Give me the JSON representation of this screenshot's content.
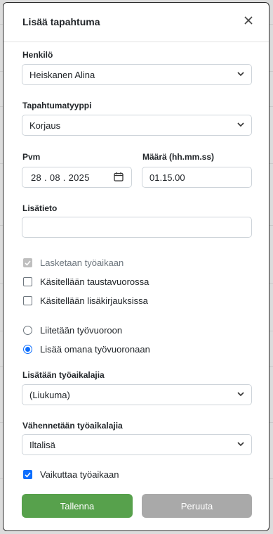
{
  "dialog": {
    "title": "Lisää tapahtuma",
    "close_icon": "close-icon"
  },
  "fields": {
    "person": {
      "label": "Henkilö",
      "value": "Heiskanen Alina"
    },
    "event_type": {
      "label": "Tapahtumatyyppi",
      "value": "Korjaus"
    },
    "date": {
      "label": "Pvm",
      "day": "28",
      "month": "08",
      "year": "2025"
    },
    "amount": {
      "label": "Määrä (hh.mm.ss)",
      "value": "01.15.00"
    },
    "extra": {
      "label": "Lisätieto",
      "value": ""
    }
  },
  "checkboxes": [
    {
      "label": "Lasketaan työaikaan",
      "checked": true,
      "disabled": true
    },
    {
      "label": "Käsitellään taustavuorossa",
      "checked": false,
      "disabled": false
    },
    {
      "label": "Käsitellään lisäkirjauksissa",
      "checked": false,
      "disabled": false
    }
  ],
  "radios": [
    {
      "label": "Liitetään työvuoroon",
      "selected": false
    },
    {
      "label": "Lisää omana työvuoronaan",
      "selected": true
    }
  ],
  "work_type_add": {
    "label": "Lisätään työaikalajia",
    "value": "(Liukuma)"
  },
  "work_type_sub": {
    "label": "Vähennetään työaikalajia",
    "value": "Iltalisä"
  },
  "affects_work_time": {
    "label": "Vaikuttaa työaikaan",
    "checked": true
  },
  "buttons": {
    "save": "Tallenna",
    "cancel": "Peruuta"
  },
  "colors": {
    "accent": "#0d6efd",
    "save": "#57a14c",
    "cancel": "#a9a9a9"
  }
}
